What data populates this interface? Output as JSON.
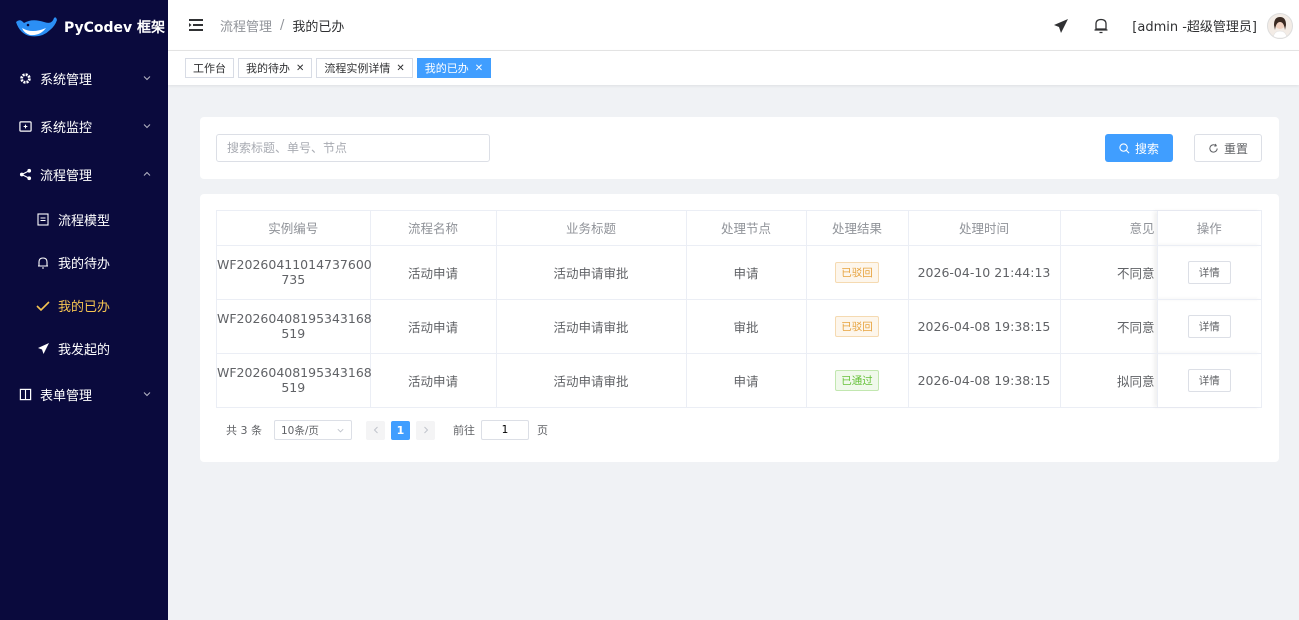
{
  "app": {
    "logo_text": "PyCodev 框架"
  },
  "sidebar": {
    "items": [
      {
        "label": "系统管理",
        "icon": "gear-icon",
        "expanded": false
      },
      {
        "label": "系统监控",
        "icon": "monitor-icon",
        "expanded": false
      },
      {
        "label": "流程管理",
        "icon": "share-icon",
        "expanded": true
      },
      {
        "label": "表单管理",
        "icon": "form-icon",
        "expanded": false
      }
    ],
    "sub_items": [
      {
        "label": "流程模型",
        "icon": "document-icon",
        "active": false
      },
      {
        "label": "我的待办",
        "icon": "bell-icon",
        "active": false
      },
      {
        "label": "我的已办",
        "icon": "check-icon",
        "active": true
      },
      {
        "label": "我发起的",
        "icon": "send-icon",
        "active": false
      }
    ]
  },
  "header": {
    "breadcrumb": [
      "流程管理",
      "我的已办"
    ],
    "breadcrumb_sep": "/",
    "user_text": "[admin -超级管理员]"
  },
  "tags": [
    {
      "label": "工作台",
      "closable": false,
      "active": false
    },
    {
      "label": "我的待办",
      "closable": true,
      "active": false
    },
    {
      "label": "流程实例详情",
      "closable": true,
      "active": false
    },
    {
      "label": "我的已办",
      "closable": true,
      "active": true
    }
  ],
  "search": {
    "placeholder": "搜索标题、单号、节点",
    "search_label": "搜索",
    "reset_label": "重置"
  },
  "table": {
    "columns": [
      "实例编号",
      "流程名称",
      "业务标题",
      "处理节点",
      "处理结果",
      "处理时间",
      "意见",
      "操作"
    ],
    "rows": [
      {
        "id_line1": "WF20260411014737600",
        "id_line2": "735",
        "flow": "活动申请",
        "title": "活动申请审批",
        "node": "申请",
        "result": "已驳回",
        "result_type": "warn",
        "time": "2026-04-10 21:44:13",
        "opinion": "不同意",
        "action": "详情"
      },
      {
        "id_line1": "WF20260408195343168",
        "id_line2": "519",
        "flow": "活动申请",
        "title": "活动申请审批",
        "node": "审批",
        "result": "已驳回",
        "result_type": "warn",
        "time": "2026-04-08 19:38:15",
        "opinion": "不同意",
        "action": "详情"
      },
      {
        "id_line1": "WF20260408195343168",
        "id_line2": "519",
        "flow": "活动申请",
        "title": "活动申请审批",
        "node": "申请",
        "result": "已通过",
        "result_type": "ok",
        "time": "2026-04-08 19:38:15",
        "opinion": "拟同意",
        "action": "详情"
      }
    ]
  },
  "pagination": {
    "total": "共 3 条",
    "page_size": "10条/页",
    "current_page": "1",
    "goto_label": "前往",
    "goto_value": "1",
    "page_suffix": "页"
  },
  "colors": {
    "sidebar_bg": "#0a0a3d",
    "active_menu": "#f5c451",
    "primary": "#409eff"
  }
}
